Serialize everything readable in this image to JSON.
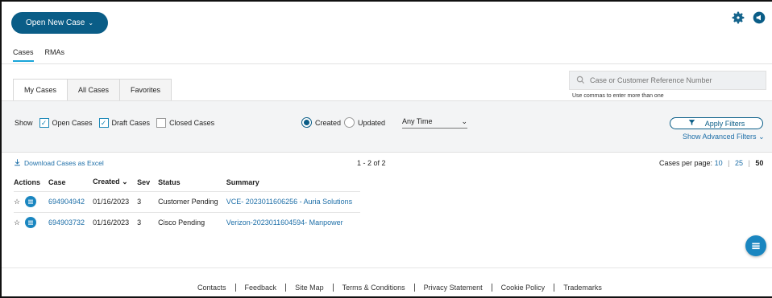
{
  "header": {
    "open_case_label": "Open New Case",
    "icons": [
      "gear-icon",
      "megaphone-icon"
    ]
  },
  "main_tabs": [
    {
      "label": "Cases",
      "active": true
    },
    {
      "label": "RMAs",
      "active": false
    }
  ],
  "sub_tabs": [
    {
      "label": "My Cases",
      "active": true
    },
    {
      "label": "All Cases",
      "active": false
    },
    {
      "label": "Favorites",
      "active": false
    }
  ],
  "search": {
    "placeholder": "Case or Customer Reference Number",
    "hint": "Use commas to enter more than one"
  },
  "filters": {
    "show_label": "Show",
    "checkboxes": [
      {
        "label": "Open Cases",
        "checked": true
      },
      {
        "label": "Draft Cases",
        "checked": true
      },
      {
        "label": "Closed Cases",
        "checked": false
      }
    ],
    "radios": [
      {
        "label": "Created",
        "selected": true
      },
      {
        "label": "Updated",
        "selected": false
      }
    ],
    "time_value": "Any Time",
    "apply_label": "Apply Filters",
    "advanced_label": "Show Advanced Filters"
  },
  "toolbar": {
    "download_label": "Download Cases as Excel",
    "range": "1 - 2 of 2",
    "per_page_label": "Cases per page:",
    "per_page_options": [
      "10",
      "25",
      "50"
    ],
    "per_page_current": "50"
  },
  "table": {
    "headers": [
      "Actions",
      "Case",
      "Created",
      "Sev",
      "Status",
      "Summary"
    ],
    "rows": [
      {
        "case": "694904942",
        "created": "01/16/2023",
        "sev": "3",
        "status": "Customer Pending",
        "summary": "VCE- 2023011606256 - Auria Solutions"
      },
      {
        "case": "694903732",
        "created": "01/16/2023",
        "sev": "3",
        "status": "Cisco Pending",
        "summary": "Verizon-2023011604594- Manpower"
      }
    ]
  },
  "footer": {
    "links": [
      "Contacts",
      "Feedback",
      "Site Map",
      "Terms & Conditions",
      "Privacy Statement",
      "Cookie Policy",
      "Trademarks"
    ]
  },
  "colors": {
    "primary": "#0a5d87",
    "link": "#1e6fa8",
    "accent_tab": "#1aa5d9",
    "chat": "#1a86c0"
  }
}
